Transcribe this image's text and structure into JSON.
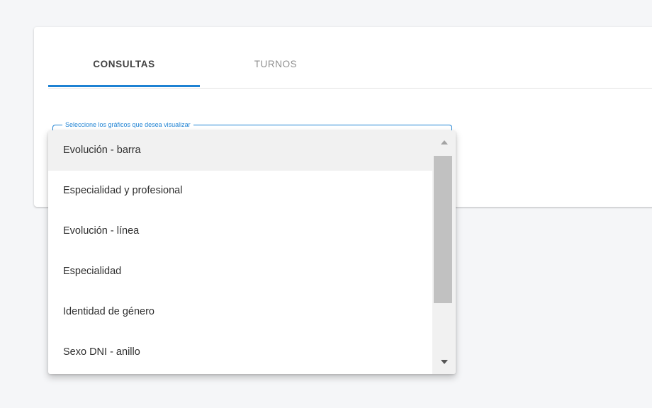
{
  "tabs": [
    {
      "label": "CONSULTAS",
      "active": true
    },
    {
      "label": "TURNOS",
      "active": false
    }
  ],
  "select": {
    "label": "Seleccione los gráficos que desea visualizar",
    "options": [
      "Evolución - barra",
      "Especialidad y profesional",
      "Evolución - línea",
      "Especialidad",
      "Identidad de género",
      "Sexo DNI - anillo"
    ],
    "highlighted_index": 0
  },
  "colors": {
    "accent": "#1e82d3",
    "background": "#f5f6f8",
    "card": "#ffffff",
    "highlight": "#f1f1f1",
    "scroll_thumb": "#c1c1c1"
  },
  "icons": {
    "scroll_up": "caret-up-icon",
    "scroll_down": "caret-down-icon"
  }
}
